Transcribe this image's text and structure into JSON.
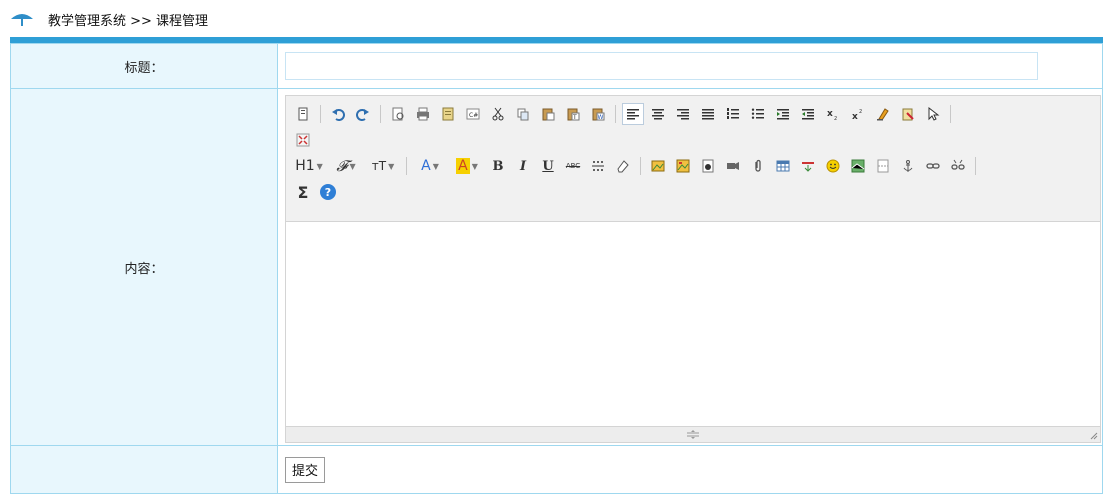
{
  "header": {
    "breadcrumb": "教学管理系统 >> 课程管理",
    "logo_icon": "umbrella-logo-icon"
  },
  "form": {
    "title_label": "标题：",
    "title_value": "",
    "content_label": "内容：",
    "submit_label": "提交"
  },
  "editor": {
    "toolbar_row1": [
      "source-icon",
      "undo-icon",
      "redo-icon",
      "preview-icon",
      "print-icon",
      "template-icon",
      "code-icon",
      "cut-icon",
      "copy-icon",
      "paste-icon",
      "paste-text-icon",
      "paste-word-icon",
      "align-left-icon",
      "align-center-icon",
      "align-right-icon",
      "align-justify-icon",
      "ordered-list-icon",
      "unordered-list-icon",
      "indent-icon",
      "outdent-icon",
      "subscript-icon",
      "superscript-icon",
      "clear-format-icon",
      "select-all-icon",
      "pointer-icon",
      "fullscreen-icon"
    ],
    "toolbar_row2": {
      "heading": "H1",
      "font_family": "𝓕",
      "font_size": "тT",
      "forecolor": "A",
      "hilitecolor": "A",
      "bold": "B",
      "italic": "I",
      "underline": "U",
      "strikethrough": "ABC",
      "sum": "Σ",
      "help": "?"
    }
  },
  "colors": {
    "accent": "#2f9fd6",
    "label_bg": "#e8f7fd",
    "border": "#9fd8ef"
  }
}
